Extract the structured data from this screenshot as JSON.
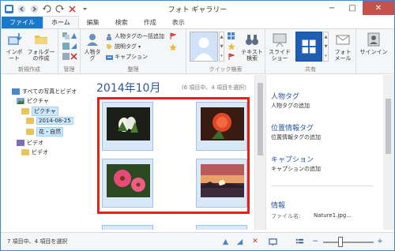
{
  "window": {
    "title": "フォト ギャラリー",
    "minimize": "−",
    "maximize": "□",
    "close": "✕"
  },
  "tabs": [
    "ファイル",
    "ホーム",
    "編集",
    "検索",
    "作成",
    "表示"
  ],
  "ribbon": {
    "new_group": {
      "label": "新規作成",
      "import": "インポート",
      "folder": "フォルダーの作成"
    },
    "manage_group": {
      "label": "管理"
    },
    "organize_group": {
      "label": "整理",
      "people_tag": "人物タグ",
      "bulk_people": "人物タグの一括追加",
      "desc_tag": "説明タグ",
      "caption": "キャプション"
    },
    "quick_find_group": {
      "label": "クイック検索",
      "text_search": "テキスト検索"
    },
    "share_group": {
      "label": "共有",
      "slideshow": "スライドショー",
      "photo_mail": "フォトメール"
    },
    "signin": "サインイン"
  },
  "nav": {
    "all": "すべての写真とビデオ",
    "pictures1": "ピクチャ",
    "pictures2": "ピクチャ",
    "date_folder": "2014-08-25",
    "flowers_folder": "花・自然",
    "videos1": "ビデオ",
    "videos2": "ビデオ"
  },
  "content": {
    "month": "2014年10月",
    "selection_info": "(6 項目中、4 項目を選択)"
  },
  "details": {
    "people_tags": "人物タグ",
    "add_people": "人物タグの追加",
    "geotag": "位置情報タグ",
    "add_geotag": "位置情報タグの追加",
    "caption": "キャプション",
    "add_caption": "キャプションの追加",
    "info": "情報",
    "filename_label": "ファイル名:",
    "filename_value": "Nature1.jpg..."
  },
  "status": {
    "text": "7 項目中、4 項目を選択"
  },
  "colors": {
    "accent": "#2b579a",
    "file_tab": "#1979ca",
    "selection": "#e2231a"
  }
}
